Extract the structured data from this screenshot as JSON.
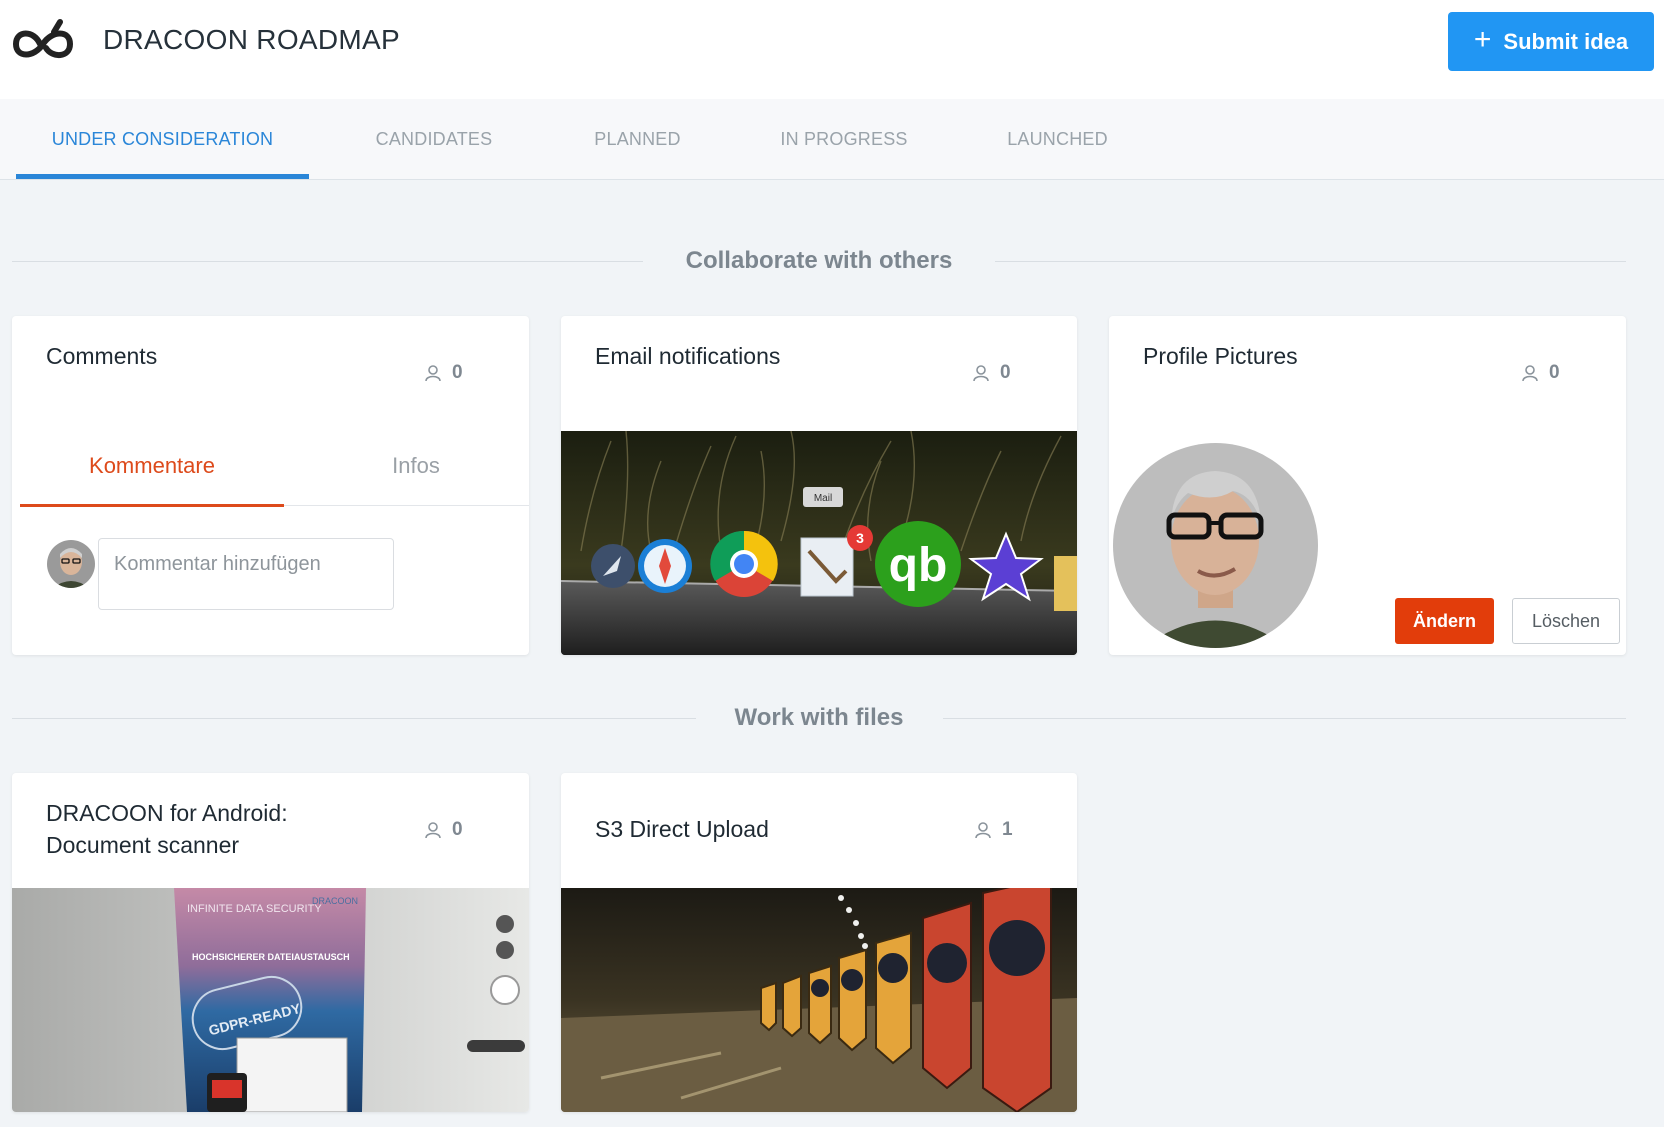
{
  "header": {
    "title": "DRACOON ROADMAP",
    "submit_label": "Submit idea"
  },
  "tabs": [
    {
      "label": "UNDER CONSIDERATION",
      "active": true
    },
    {
      "label": "CANDIDATES",
      "active": false
    },
    {
      "label": "PLANNED",
      "active": false
    },
    {
      "label": "IN PROGRESS",
      "active": false
    },
    {
      "label": "LAUNCHED",
      "active": false
    }
  ],
  "sections": [
    {
      "title": "Collaborate with others",
      "cards": [
        {
          "title": "Comments",
          "votes": "0",
          "subtabs": [
            {
              "label": "Kommentare",
              "active": true
            },
            {
              "label": "Infos",
              "active": false
            }
          ],
          "comment_placeholder": "Kommentar hinzufügen"
        },
        {
          "title": "Email notifications",
          "votes": "0",
          "image_badge_label": "Mail",
          "image_badge_count": "3"
        },
        {
          "title": "Profile Pictures",
          "votes": "0",
          "change_label": "Ändern",
          "delete_label": "Löschen"
        }
      ]
    },
    {
      "title": "Work with files",
      "cards": [
        {
          "title_line1": "DRACOON for Android:",
          "title_line2": "Document scanner",
          "votes": "0",
          "image_texts": {
            "brand": "DRACOON",
            "headline": "INFINITE DATA SECURITY",
            "sub": "HOCHSICHERER DATEIAUSTAUSCH",
            "stamp": "GDPR-READY"
          }
        },
        {
          "title": "S3 Direct Upload",
          "votes": "1"
        }
      ]
    }
  ],
  "colors": {
    "accent": "#2196f3",
    "tab_active": "#2a86d8",
    "kommentare_active": "#dd4a1b",
    "change_button": "#e23d0b"
  }
}
